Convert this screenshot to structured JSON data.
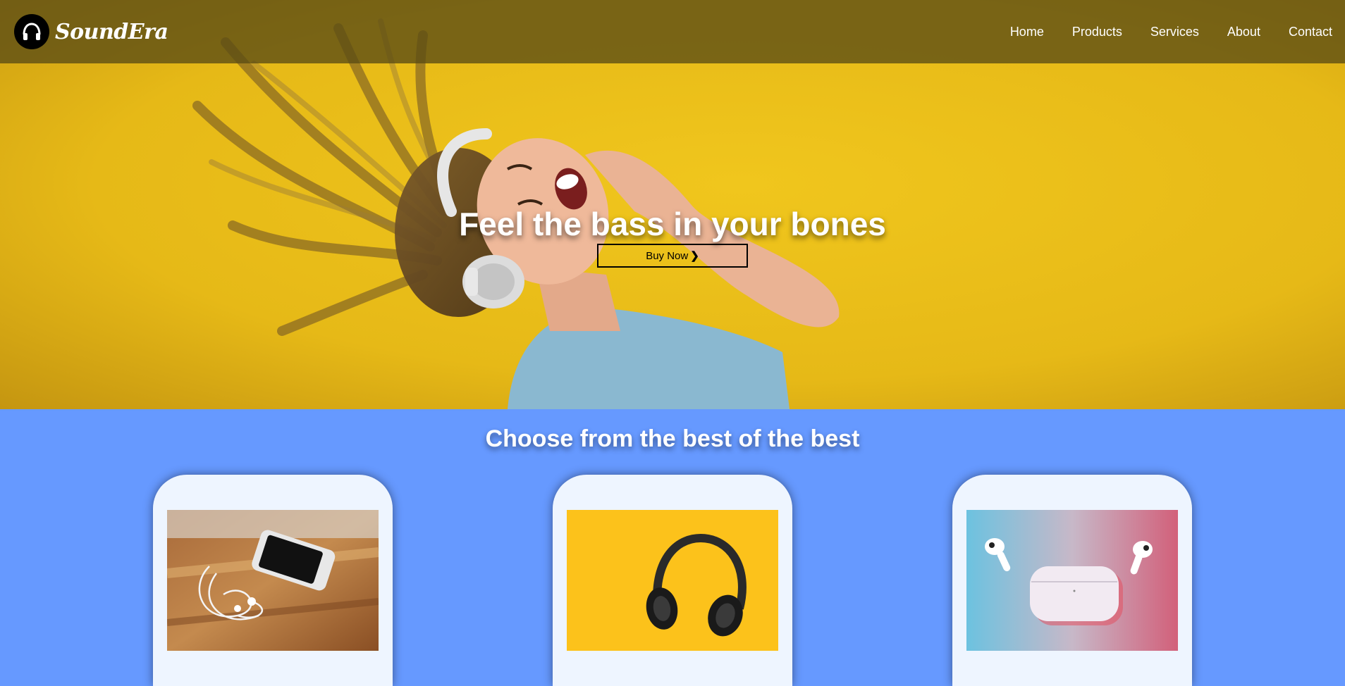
{
  "brand": {
    "name": "SoundEra",
    "logo_icon": "headphones-icon"
  },
  "nav": {
    "items": [
      {
        "label": "Home"
      },
      {
        "label": "Products"
      },
      {
        "label": "Services"
      },
      {
        "label": "About"
      },
      {
        "label": "Contact"
      }
    ]
  },
  "hero": {
    "title": "Feel the bass in your bones",
    "button_label": "Buy Now",
    "button_icon": "chevron-right-icon"
  },
  "products": {
    "title": "Choose from the best of the best",
    "cards": [
      {
        "image": "wired-earphones-with-phone-image"
      },
      {
        "image": "over-ear-headphones-image"
      },
      {
        "image": "wireless-earbuds-with-case-image"
      }
    ]
  },
  "colors": {
    "navbar_bg": "#5a4b14",
    "hero_bg": "#e6bb18",
    "section_bg": "#6699ff",
    "card_bg": "#eef5ff",
    "text_light": "#ffffff"
  }
}
